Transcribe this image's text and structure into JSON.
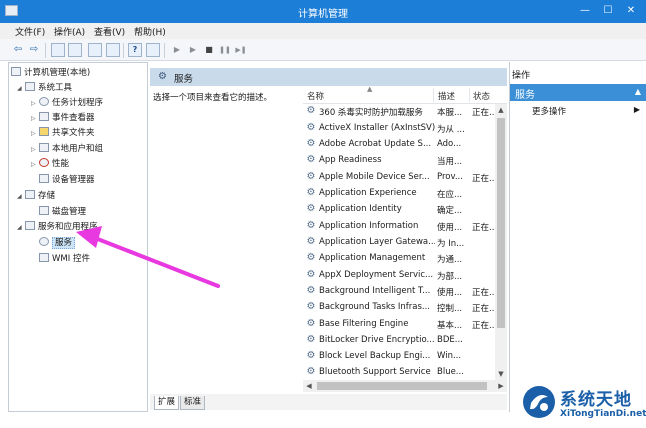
{
  "window": {
    "title": "计算机管理",
    "minimize": "—",
    "maximize": "☐",
    "close": "✕"
  },
  "menu": [
    "文件(F)",
    "操作(A)",
    "查看(V)",
    "帮助(H)"
  ],
  "toolbar": {
    "back": "⇦",
    "forward": "⇨",
    "icons": [
      "folder-up-icon",
      "properties-icon",
      "refresh-icon",
      "export-icon",
      "help-icon",
      "console-icon",
      "start-service-icon",
      "play-icon",
      "stop-icon",
      "pause-icon",
      "restart-icon"
    ],
    "help_label": "?",
    "play": "▶",
    "play2": "▶",
    "stop": "■",
    "pause": "❚❚",
    "restart": "▶❚"
  },
  "tree": {
    "root": "计算机管理(本地)",
    "system_tools": "系统工具",
    "task_scheduler": "任务计划程序",
    "event_viewer": "事件查看器",
    "shared_folders": "共享文件夹",
    "local_users": "本地用户和组",
    "performance": "性能",
    "device_manager": "设备管理器",
    "storage": "存储",
    "disk_management": "磁盘管理",
    "services_apps": "服务和应用程序",
    "services": "服务",
    "wmi": "WMI 控件"
  },
  "center": {
    "header": "服务",
    "description": "选择一个项目来查看它的描述。",
    "columns": {
      "name": "名称",
      "description": "描述",
      "status": "状态"
    },
    "rows": [
      {
        "name": "360 杀毒实时防护加载服务",
        "desc": "本服...",
        "status": "正在..."
      },
      {
        "name": "ActiveX Installer (AxInstSV)",
        "desc": "为从 ...",
        "status": ""
      },
      {
        "name": "Adobe Acrobat Update S...",
        "desc": "Ado...",
        "status": ""
      },
      {
        "name": "App Readiness",
        "desc": "当用...",
        "status": ""
      },
      {
        "name": "Apple Mobile Device Ser...",
        "desc": "Prov...",
        "status": "正在..."
      },
      {
        "name": "Application Experience",
        "desc": "在应...",
        "status": ""
      },
      {
        "name": "Application Identity",
        "desc": "确定...",
        "status": ""
      },
      {
        "name": "Application Information",
        "desc": "使用...",
        "status": "正在..."
      },
      {
        "name": "Application Layer Gatewa...",
        "desc": "为 In...",
        "status": ""
      },
      {
        "name": "Application Management",
        "desc": "为通...",
        "status": ""
      },
      {
        "name": "AppX Deployment Servic...",
        "desc": "为部...",
        "status": ""
      },
      {
        "name": "Background Intelligent T...",
        "desc": "使用...",
        "status": "正在..."
      },
      {
        "name": "Background Tasks Infras...",
        "desc": "控制...",
        "status": "正在..."
      },
      {
        "name": "Base Filtering Engine",
        "desc": "基本...",
        "status": "正在..."
      },
      {
        "name": "BitLocker Drive Encryptio...",
        "desc": "BDE...",
        "status": ""
      },
      {
        "name": "Block Level Backup Engi...",
        "desc": "Win...",
        "status": ""
      },
      {
        "name": "Bluetooth Support Service",
        "desc": "Blue...",
        "status": ""
      }
    ],
    "tabs": [
      "扩展",
      "标准"
    ]
  },
  "actions": {
    "header": "操作",
    "section": "服务",
    "more": "更多操作"
  },
  "watermark": {
    "cn": "系统天地",
    "en": "XiTongTianDi.net"
  },
  "colors": {
    "titlebar": "#1d7ed8",
    "actions_section": "#3a8fd6",
    "header_band": "#c9daeb",
    "annotation_arrow": "#e838e0"
  }
}
